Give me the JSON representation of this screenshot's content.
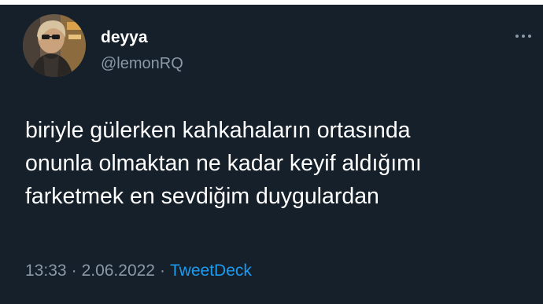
{
  "tweet": {
    "display_name": "deyya",
    "handle": "@lemonRQ",
    "text": "biriyle gülerken kahkahaların ortasında\nonunla olmaktan ne kadar keyif aldığımı\nfarketmek en sevdiğim duygulardan",
    "time": "13:33",
    "date": "2.06.2022",
    "separator": "·",
    "source": "TweetDeck"
  },
  "icons": {
    "more": "more-dots-icon",
    "avatar": "profile-avatar"
  },
  "colors": {
    "background": "#15202b",
    "text_primary": "#ffffff",
    "text_secondary": "#8b98a5",
    "accent": "#1d9bf0"
  }
}
